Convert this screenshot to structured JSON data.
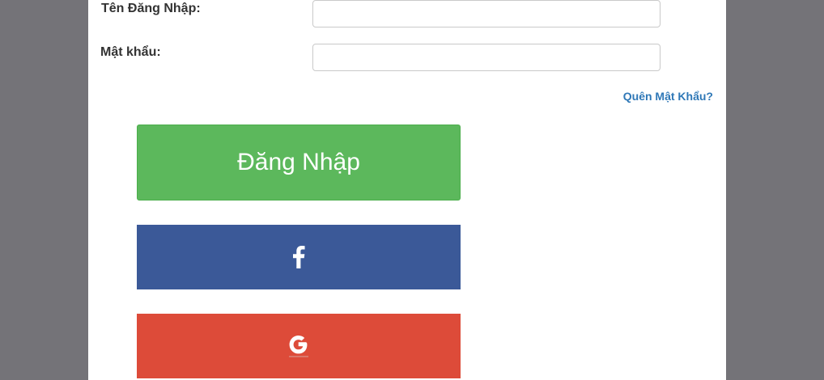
{
  "form": {
    "username_label": "Tên Đăng Nhập:",
    "username_value": "",
    "password_label": "Mật khẩu:",
    "password_value": "",
    "forgot_password": "Quên Mật Khẩu?",
    "login_button": "Đăng Nhập"
  },
  "social": {
    "facebook_icon": "facebook-f-icon",
    "google_icon": "google-g-icon"
  },
  "colors": {
    "backdrop": "#747378",
    "login_green": "#5cb85c",
    "facebook_blue": "#3b5998",
    "google_red": "#dd4b39",
    "link_blue": "#2f78b7"
  }
}
